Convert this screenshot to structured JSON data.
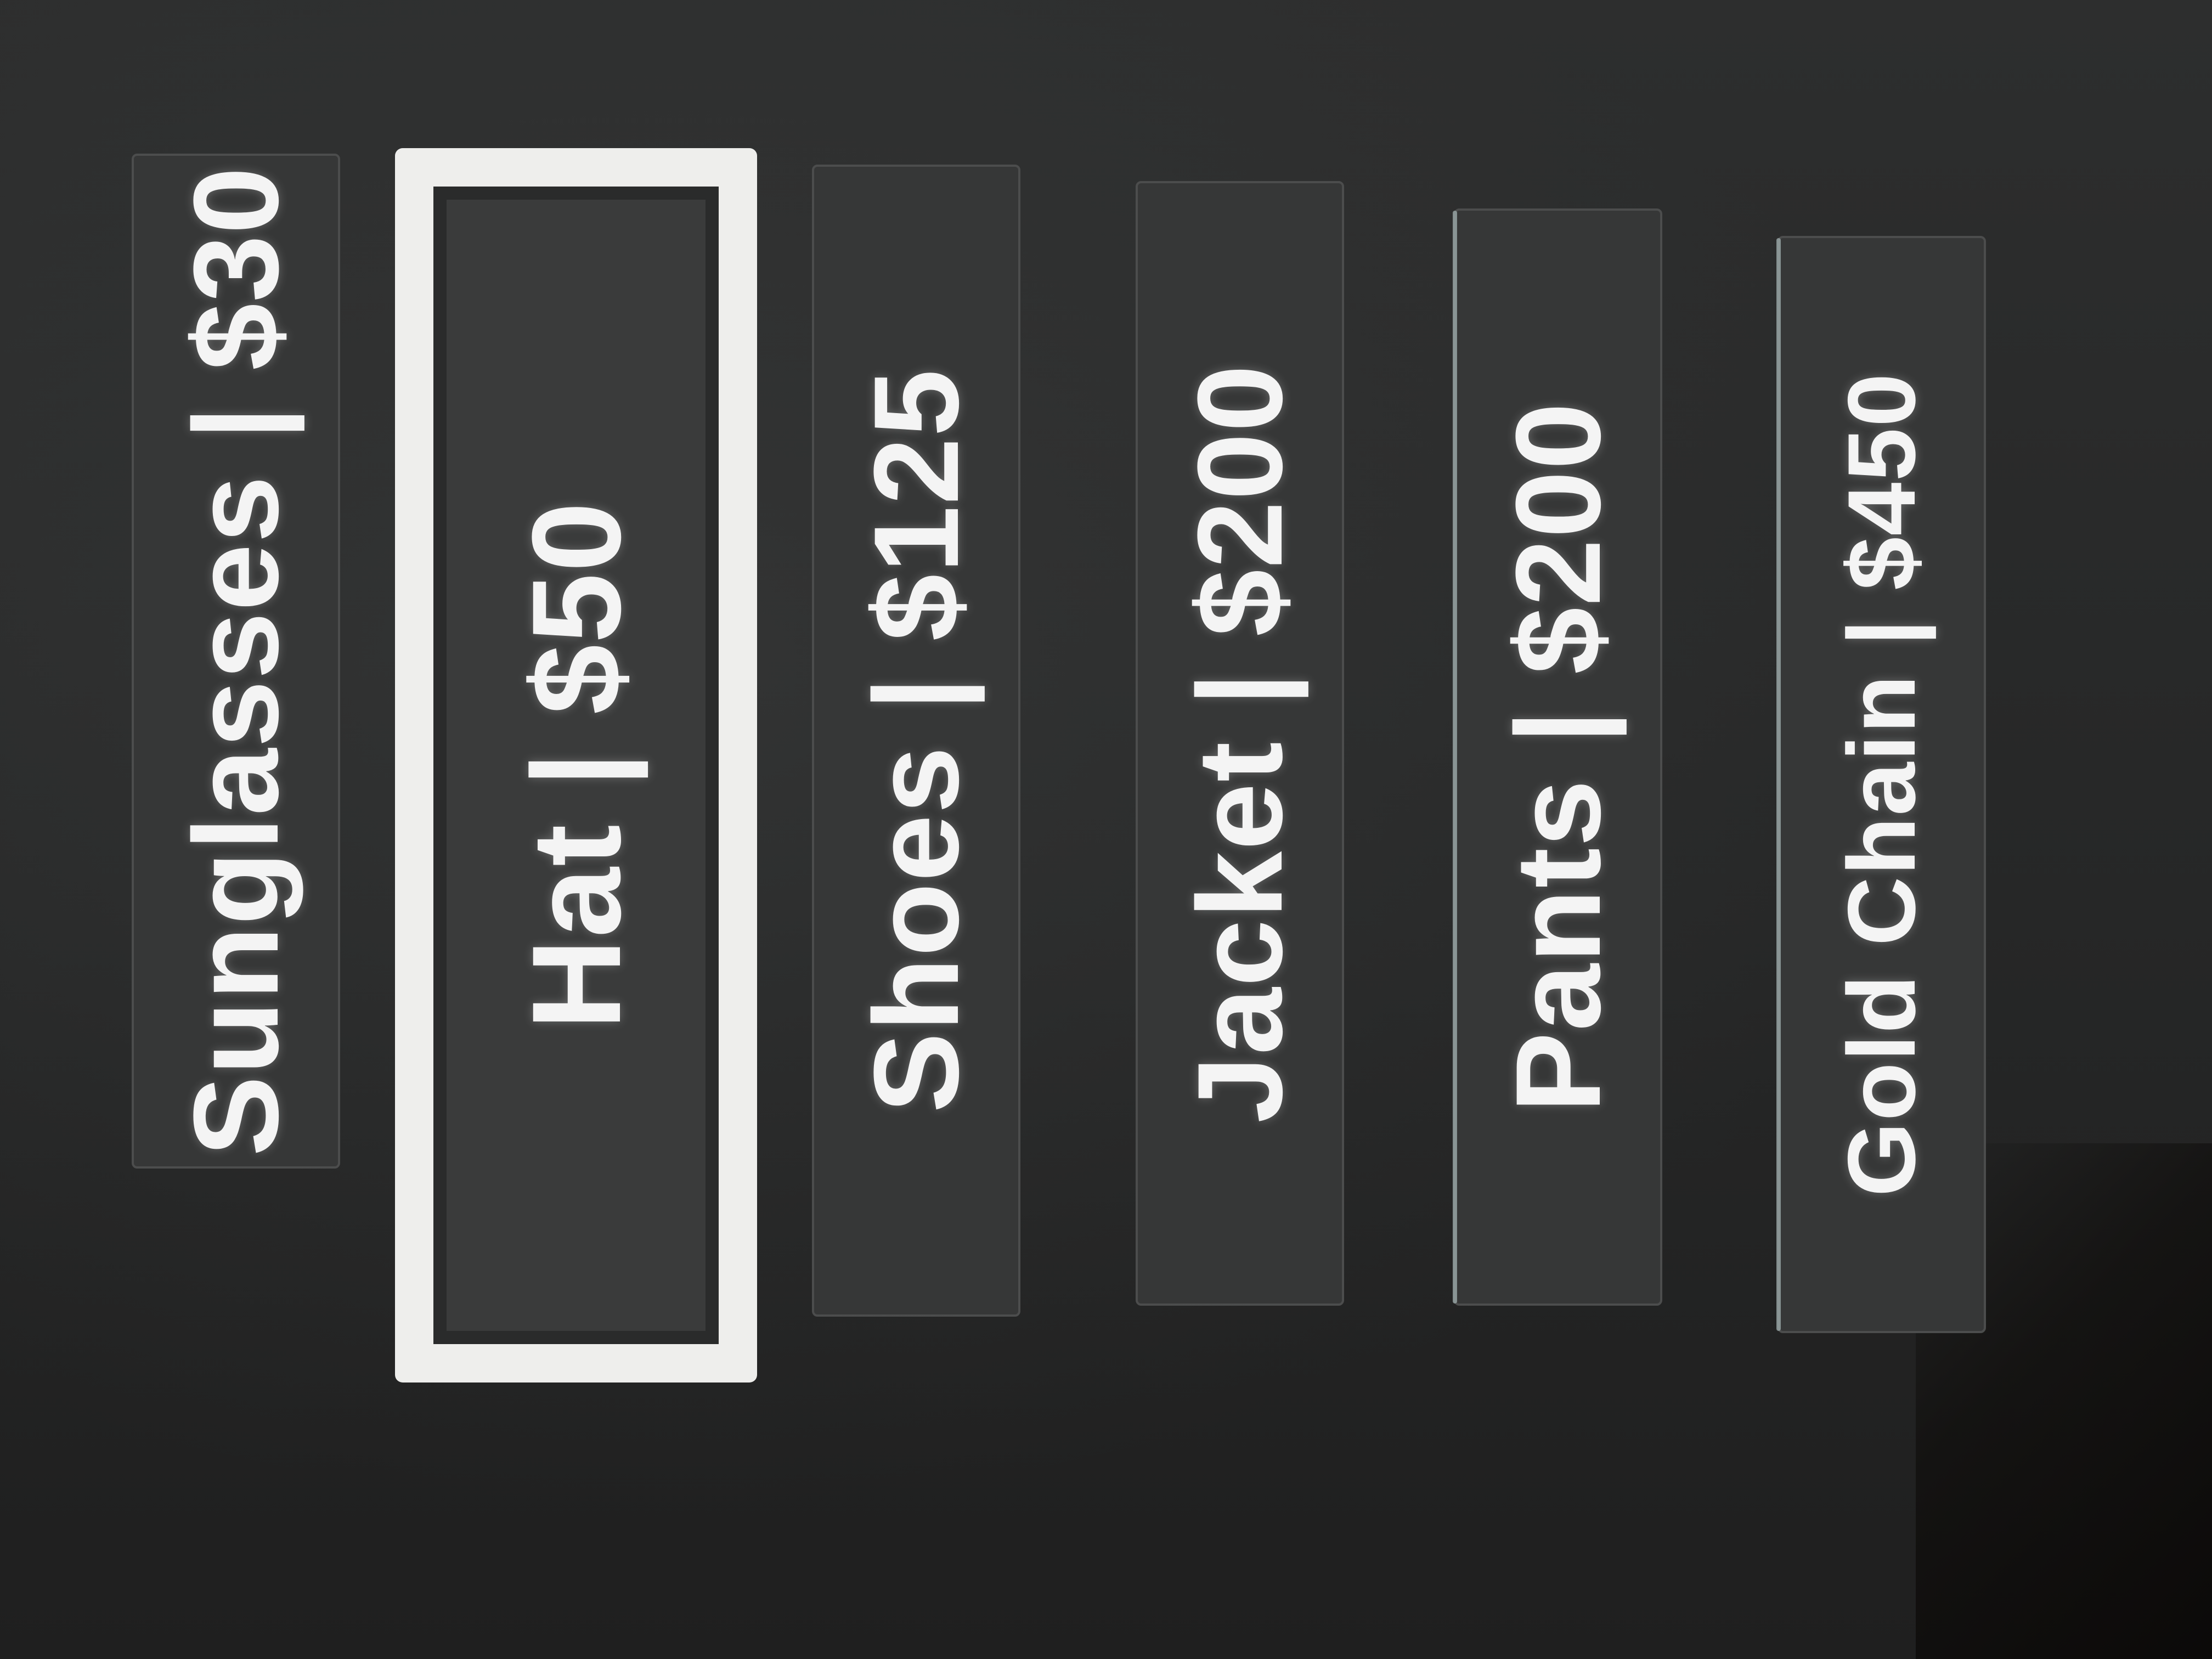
{
  "shop": {
    "selected_index": 1,
    "items": [
      {
        "label": "Sunglasses | $30"
      },
      {
        "label": "Hat | $50"
      },
      {
        "label": "Shoes | $125"
      },
      {
        "label": "Jacket | $200"
      },
      {
        "label": "Pants | $200"
      },
      {
        "label": "Gold Chain | $450"
      }
    ]
  },
  "colors": {
    "background": "#262626",
    "item_background": "#363737",
    "selection_border": "#eeeeec",
    "text": "#f4f4f4"
  }
}
